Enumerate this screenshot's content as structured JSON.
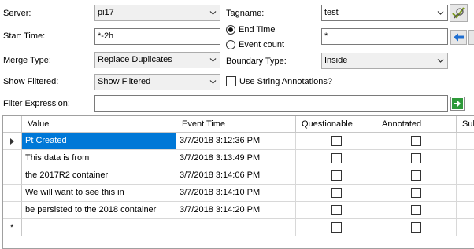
{
  "form": {
    "server_label": "Server:",
    "server_value": "pi17",
    "tagname_label": "Tagname:",
    "tagname_value": "test",
    "start_time_label": "Start Time:",
    "start_time_value": "*-2h",
    "end_time_option": "End Time",
    "event_count_option": "Event count",
    "end_time_value": "*",
    "merge_type_label": "Merge Type:",
    "merge_type_value": "Replace Duplicates",
    "boundary_type_label": "Boundary Type:",
    "boundary_type_value": "Inside",
    "show_filtered_label": "Show Filtered:",
    "show_filtered_value": "Show Filtered",
    "use_string_annotations_label": "Use String Annotations?",
    "filter_expression_label": "Filter Expression:",
    "filter_expression_value": ""
  },
  "grid": {
    "columns": [
      "Value",
      "Event Time",
      "Questionable",
      "Annotated",
      "Sub"
    ],
    "rows": [
      {
        "value": "Pt Created",
        "event_time": "3/7/2018 3:12:36 PM"
      },
      {
        "value": "This data is from",
        "event_time": "3/7/2018 3:13:49 PM"
      },
      {
        "value": "the 2017R2 container",
        "event_time": "3/7/2018 3:14:06 PM"
      },
      {
        "value": "We will want to see this in",
        "event_time": "3/7/2018 3:14:10 PM"
      },
      {
        "value": "be persisted to the 2018 container",
        "event_time": "3/7/2018 3:14:20 PM"
      }
    ],
    "new_row_marker": "*"
  }
}
